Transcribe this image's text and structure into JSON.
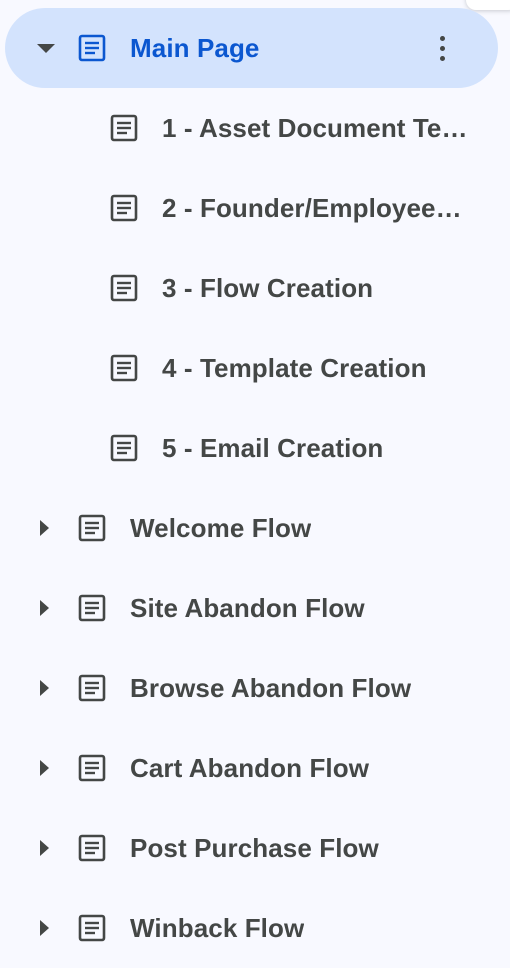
{
  "outline": {
    "main_page": {
      "label": "Main Page",
      "icon": "document-icon",
      "expanded": true,
      "selected": true,
      "accent_color": "#0b57d0",
      "highlight_color": "#d3e3fd"
    },
    "sub_items": [
      {
        "label": "1 - Asset Document Te…",
        "icon": "document-icon"
      },
      {
        "label": "2 - Founder/Employee…",
        "icon": "document-icon"
      },
      {
        "label": "3 - Flow Creation",
        "icon": "document-icon"
      },
      {
        "label": "4 - Template Creation",
        "icon": "document-icon"
      },
      {
        "label": "5 - Email Creation",
        "icon": "document-icon"
      }
    ],
    "flows": [
      {
        "label": "Welcome Flow",
        "icon": "document-icon",
        "expanded": false
      },
      {
        "label": "Site Abandon Flow",
        "icon": "document-icon",
        "expanded": false
      },
      {
        "label": "Browse Abandon Flow",
        "icon": "document-icon",
        "expanded": false
      },
      {
        "label": "Cart Abandon Flow",
        "icon": "document-icon",
        "expanded": false
      },
      {
        "label": "Post Purchase Flow",
        "icon": "document-icon",
        "expanded": false
      },
      {
        "label": "Winback Flow",
        "icon": "document-icon",
        "expanded": false
      }
    ]
  }
}
